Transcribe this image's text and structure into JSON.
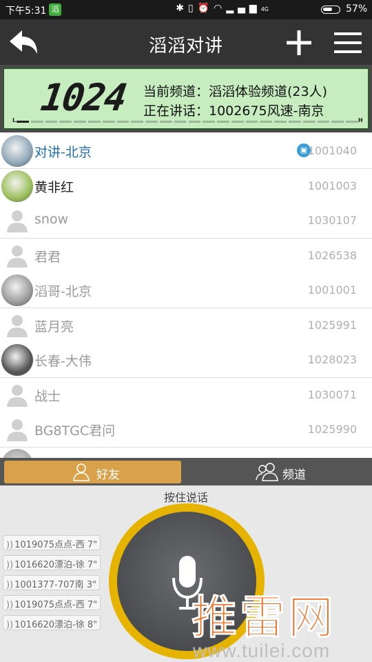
{
  "status_bar": {
    "time": "下午5:31",
    "app_icon": "滔",
    "icons": [
      "bluetooth-icon",
      "vibrate-icon",
      "alarm-icon",
      "wifi-icon",
      "signal-icon"
    ],
    "signal_label": "4G",
    "battery": "57%",
    "battery_level": 0.57
  },
  "header": {
    "title": "滔滔对讲",
    "icons": [
      "back-arrow-icon",
      "plus-icon",
      "menu-icon"
    ]
  },
  "lcd": {
    "channel_number": "1024",
    "current_channel": "当前频道：滔滔体验频道(23人)",
    "speaking": "正在讲话：1002675风速-南京",
    "meter_low": "L",
    "meter_high": "H",
    "meter_level": 0.05
  },
  "contacts": [
    {
      "name": "对讲-北京",
      "id": "1001040",
      "state": "highlight",
      "avatar": "photo",
      "badge": true
    },
    {
      "name": "黄非红",
      "id": "1001003",
      "state": "online",
      "avatar": "photo"
    },
    {
      "name": "snow",
      "id": "1030107",
      "state": "offline",
      "avatar": "default"
    },
    {
      "name": "君君",
      "id": "1026538",
      "state": "offline",
      "avatar": "default"
    },
    {
      "name": "滔哥-北京",
      "id": "1001001",
      "state": "offline",
      "avatar": "photo"
    },
    {
      "name": "蓝月亮",
      "id": "1025991",
      "state": "offline",
      "avatar": "default"
    },
    {
      "name": "长春-大伟",
      "id": "1028023",
      "state": "offline",
      "avatar": "photo"
    },
    {
      "name": "战士",
      "id": "1030071",
      "state": "offline",
      "avatar": "default"
    },
    {
      "name": "BG8TGC君问",
      "id": "1025990",
      "state": "offline",
      "avatar": "default"
    }
  ],
  "tabs": [
    {
      "label": "好友",
      "active": true,
      "icon": "person-icon"
    },
    {
      "label": "频道",
      "active": false,
      "icon": "group-icon"
    }
  ],
  "ptt": {
    "hint": "按住说话",
    "icon": "microphone-icon"
  },
  "history": [
    "1019075点点-西 7\"",
    "1016620漂泊-徐 7\"",
    "1001377-707南 3\"",
    "1019075点点-西 7\"",
    "1016620漂泊-徐 8\""
  ],
  "watermark": {
    "main": "推雷网",
    "url": "www.tuilei.com"
  },
  "colors": {
    "header_bg": "#333333",
    "lcd_bg": "#c6ecc0",
    "tab_active": "#d9a24a",
    "ptt_ring": "#e6b400",
    "highlight_text": "#1e6fb5",
    "watermark": "#f26b1d"
  }
}
